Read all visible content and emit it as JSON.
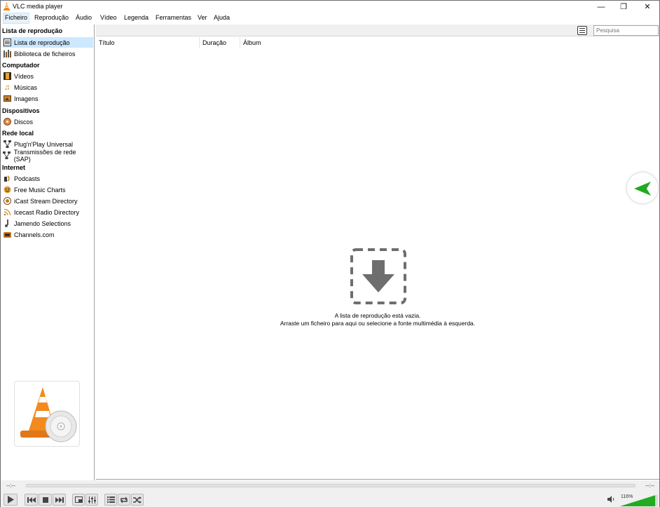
{
  "window": {
    "title": "VLC media player",
    "min_glyph": "—",
    "max_glyph": "❐",
    "close_glyph": "✕"
  },
  "menu": [
    {
      "label": "Ficheiro"
    },
    {
      "label": "Reprodução"
    },
    {
      "label": "Áudio"
    },
    {
      "label": "Vídeo"
    },
    {
      "label": "Legenda"
    },
    {
      "label": "Ferramentas"
    },
    {
      "label": "Ver"
    },
    {
      "label": "Ajuda"
    }
  ],
  "sidebar": {
    "sections": {
      "playlist": "Lista de reprodução",
      "computer": "Computador",
      "devices": "Dispositivos",
      "lan": "Rede local",
      "internet": "Internet"
    },
    "items": {
      "playlist": "Lista de reprodução",
      "library": "Biblioteca de ficheiros",
      "videos": "Vídeos",
      "music": "Músicas",
      "images": "Imagens",
      "discs": "Discos",
      "upnp": "Plug'n'Play Universal",
      "sap": "Transmissões de rede (SAP)",
      "podcasts": "Podcasts",
      "freemusic": "Free Music Charts",
      "icast": "iCast Stream Directory",
      "icecast": "Icecast Radio Directory",
      "jamendo": "Jamendo Selections",
      "channels": "Channels.com"
    }
  },
  "search": {
    "placeholder": "Pesquisa"
  },
  "columns": {
    "title": "Título",
    "duration": "Duração",
    "album": "Álbum"
  },
  "empty": {
    "line1": "A lista de reprodução está vazia.",
    "line2": "Arraste um ficheiro para aqui ou selecione a fonte multimédia à esquerda."
  },
  "seek": {
    "elapsed": "--:--",
    "total": "--:--"
  },
  "volume": {
    "percent_label": "116%",
    "level": 1.16
  },
  "colors": {
    "accent_green": "#22aa22",
    "selection": "#cde8ff",
    "vlc_orange": "#f28a1e"
  }
}
